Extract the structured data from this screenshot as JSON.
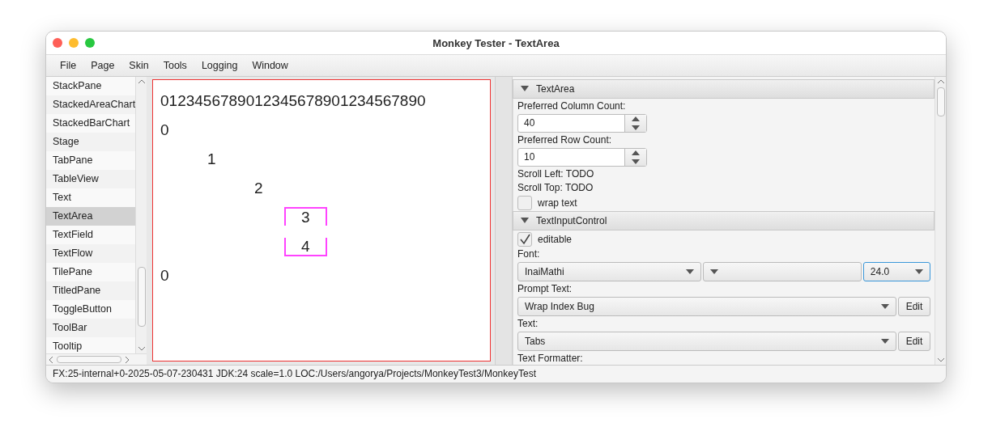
{
  "window": {
    "title": "Monkey Tester - TextArea"
  },
  "menu": [
    "File",
    "Page",
    "Skin",
    "Tools",
    "Logging",
    "Window"
  ],
  "sidebar": {
    "items": [
      {
        "label": "StackPane",
        "selected": false
      },
      {
        "label": "StackedAreaChart",
        "selected": false
      },
      {
        "label": "StackedBarChart",
        "selected": false
      },
      {
        "label": "Stage",
        "selected": false
      },
      {
        "label": "TabPane",
        "selected": false
      },
      {
        "label": "TableView",
        "selected": false
      },
      {
        "label": "Text",
        "selected": false
      },
      {
        "label": "TextArea",
        "selected": true
      },
      {
        "label": "TextField",
        "selected": false
      },
      {
        "label": "TextFlow",
        "selected": false
      },
      {
        "label": "TilePane",
        "selected": false
      },
      {
        "label": "TitledPane",
        "selected": false
      },
      {
        "label": "ToggleButton",
        "selected": false
      },
      {
        "label": "ToolBar",
        "selected": false
      },
      {
        "label": "Tooltip",
        "selected": false
      }
    ]
  },
  "text_area": {
    "lines": [
      {
        "text": "0123456789012345678901234567890",
        "highlighted": false
      },
      {
        "text": "0",
        "highlighted": false
      },
      {
        "text": "\t1",
        "highlighted": false
      },
      {
        "text": "\t\t2",
        "highlighted": false
      },
      {
        "text": "\t\t\t3",
        "highlighted": true
      },
      {
        "text": "\t\t\t4",
        "highlighted": true
      },
      {
        "text": "0",
        "highlighted": false
      }
    ]
  },
  "textarea_section": {
    "title": "TextArea",
    "expanded": true,
    "column_label": "Preferred Column Count:",
    "column_value": "40",
    "row_label": "Preferred Row Count:",
    "row_value": "10",
    "scroll_left": "Scroll Left: TODO",
    "scroll_top": "Scroll Top: TODO",
    "wrap_text": {
      "label": "wrap text",
      "checked": false
    }
  },
  "textinput_section": {
    "title": "TextInputControl",
    "expanded": true,
    "editable": {
      "label": "editable",
      "checked": true
    },
    "font_label": "Font:",
    "font_family": "InaiMathi",
    "font_size": "24.0",
    "prompt_label": "Prompt Text:",
    "prompt_value": "Wrap Index Bug",
    "prompt_button": "Edit",
    "text_label": "Text:",
    "text_value": "Tabs",
    "text_button": "Edit",
    "formatter_label": "Text Formatter:"
  },
  "status_bar": "FX:25-internal+0-2025-05-07-230431  JDK:24  scale=1.0  LOC:/Users/angorya/Projects/MonkeyTest3/MonkeyTest"
}
